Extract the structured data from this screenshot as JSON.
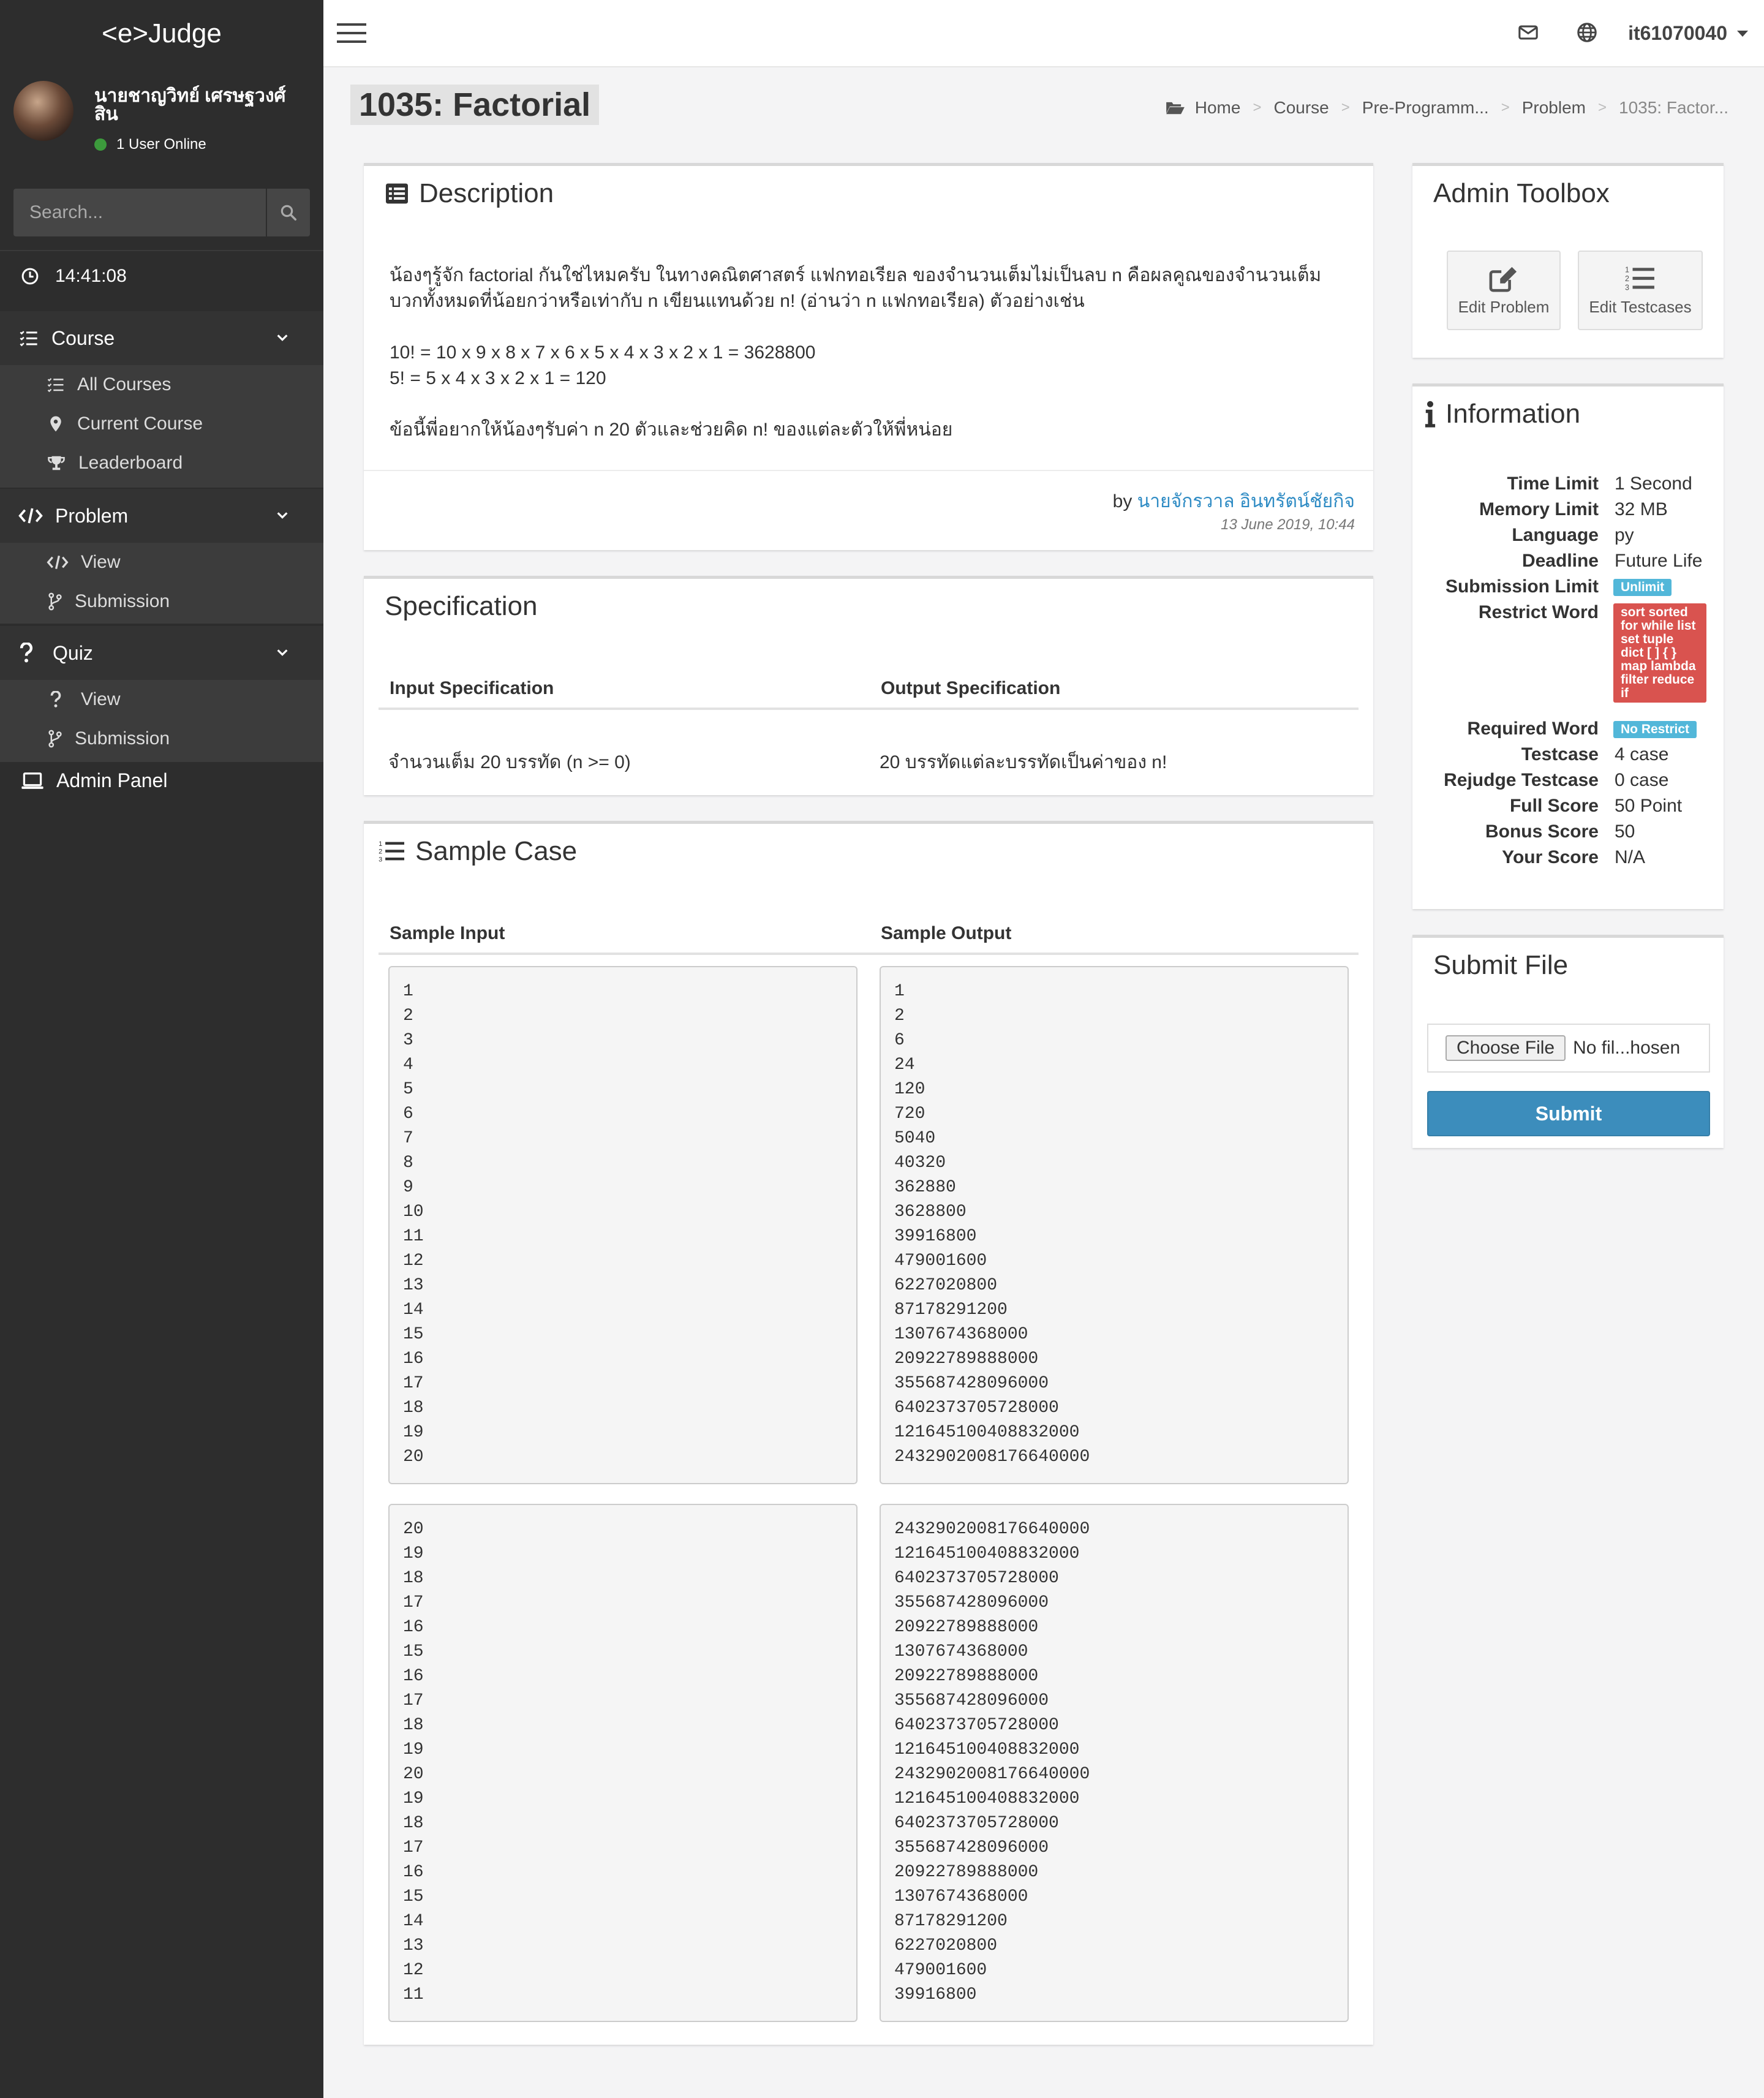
{
  "brand": "<e>Judge",
  "user": {
    "name": "นายชาญวิทย์ เศรษฐวงศ์สิน",
    "online": "1 User Online"
  },
  "search": {
    "placeholder": "Search..."
  },
  "clock": "14:41:08",
  "nav": {
    "course": {
      "label": "Course",
      "items": [
        "All Courses",
        "Current Course",
        "Leaderboard"
      ]
    },
    "problem": {
      "label": "Problem",
      "items": [
        "View",
        "Submission"
      ]
    },
    "quiz": {
      "label": "Quiz",
      "items": [
        "View",
        "Submission"
      ]
    },
    "admin": "Admin Panel"
  },
  "topbar": {
    "username": "it61070040"
  },
  "title": "1035: Factorial",
  "breadcrumb": [
    "Home",
    "Course",
    "Pre-Programm...",
    "Problem",
    "1035: Factor..."
  ],
  "description": {
    "heading": "Description",
    "para1": "น้องๆรู้จัก factorial กันใช่ไหมครับ ในทางคณิตศาสตร์ แฟกทอเรียล ของจำนวนเต็มไม่เป็นลบ n คือผลคูณของจำนวนเต็มบวกทั้งหมดที่น้อยกว่าหรือเท่ากับ n เขียนแทนด้วย n! (อ่านว่า n แฟกทอเรียล) ตัวอย่างเช่น",
    "ex1": "10! = 10 x 9 x 8 x 7 x 6 x 5 x 4 x 3 x 2 x 1 = 3628800",
    "ex2": "5! = 5 x 4 x 3 x 2 x 1 =  120",
    "para2": "ข้อนี้พี่อยากให้น้องๆรับค่า n 20 ตัวและช่วยคิด n! ของแต่ละตัวให้พี่หน่อย",
    "by": "by",
    "author": "นายจักรวาล อินทรัตน์ชัยกิจ",
    "date": "13 June 2019, 10:44"
  },
  "spec": {
    "heading": "Specification",
    "input_head": "Input Specification",
    "output_head": "Output Specification",
    "input": "จำนวนเต็ม 20 บรรทัด (n >= 0)",
    "output": "20 บรรทัดแต่ละบรรทัดเป็นค่าของ n!"
  },
  "sample": {
    "heading": "Sample Case",
    "input_head": "Sample Input",
    "output_head": "Sample Output",
    "in1": [
      "1",
      "2",
      "3",
      "4",
      "5",
      "6",
      "7",
      "8",
      "9",
      "10",
      "11",
      "12",
      "13",
      "14",
      "15",
      "16",
      "17",
      "18",
      "19",
      "20"
    ],
    "out1": [
      "1",
      "2",
      "6",
      "24",
      "120",
      "720",
      "5040",
      "40320",
      "362880",
      "3628800",
      "39916800",
      "479001600",
      "6227020800",
      "87178291200",
      "1307674368000",
      "20922789888000",
      "355687428096000",
      "6402373705728000",
      "121645100408832000",
      "2432902008176640000"
    ],
    "in2": [
      "20",
      "19",
      "18",
      "17",
      "16",
      "15",
      "16",
      "17",
      "18",
      "19",
      "20",
      "19",
      "18",
      "17",
      "16",
      "15",
      "14",
      "13",
      "12",
      "11"
    ],
    "out2": [
      "2432902008176640000",
      "121645100408832000",
      "6402373705728000",
      "355687428096000",
      "20922789888000",
      "1307674368000",
      "20922789888000",
      "355687428096000",
      "6402373705728000",
      "121645100408832000",
      "2432902008176640000",
      "121645100408832000",
      "6402373705728000",
      "355687428096000",
      "20922789888000",
      "1307674368000",
      "87178291200",
      "6227020800",
      "479001600",
      "39916800"
    ]
  },
  "toolbox": {
    "heading": "Admin Toolbox",
    "edit_problem": "Edit Problem",
    "edit_testcases": "Edit Testcases"
  },
  "info": {
    "heading": "Information",
    "time_limit_k": "Time Limit",
    "time_limit": "1 Second",
    "memory_k": "Memory Limit",
    "memory": "32 MB",
    "language_k": "Language",
    "language": "py",
    "deadline_k": "Deadline",
    "deadline": "Future Life",
    "sublimit_k": "Submission Limit",
    "sublimit": "Unlimit",
    "restrict_k": "Restrict Word",
    "restrict": "sort sorted for while list set tuple dict [ ] { } map lambda filter reduce if",
    "required_k": "Required Word",
    "required": "No Restrict",
    "testcase_k": "Testcase",
    "testcase": "4 case",
    "rejudge_k": "Rejudge Testcase",
    "rejudge": "0 case",
    "full_k": "Full Score",
    "full": "50 Point",
    "bonus_k": "Bonus Score",
    "bonus": "50",
    "your_k": "Your Score",
    "your": "N/A"
  },
  "submit": {
    "heading": "Submit File",
    "choose": "Choose File",
    "nofile": "No fil...hosen",
    "button": "Submit"
  },
  "colors": {
    "sidebar": "#2d2d2d",
    "primary": "#3c8dbc",
    "info_label": "#52b7d9",
    "danger_label": "#d9534f",
    "link": "#2e8bc4"
  }
}
